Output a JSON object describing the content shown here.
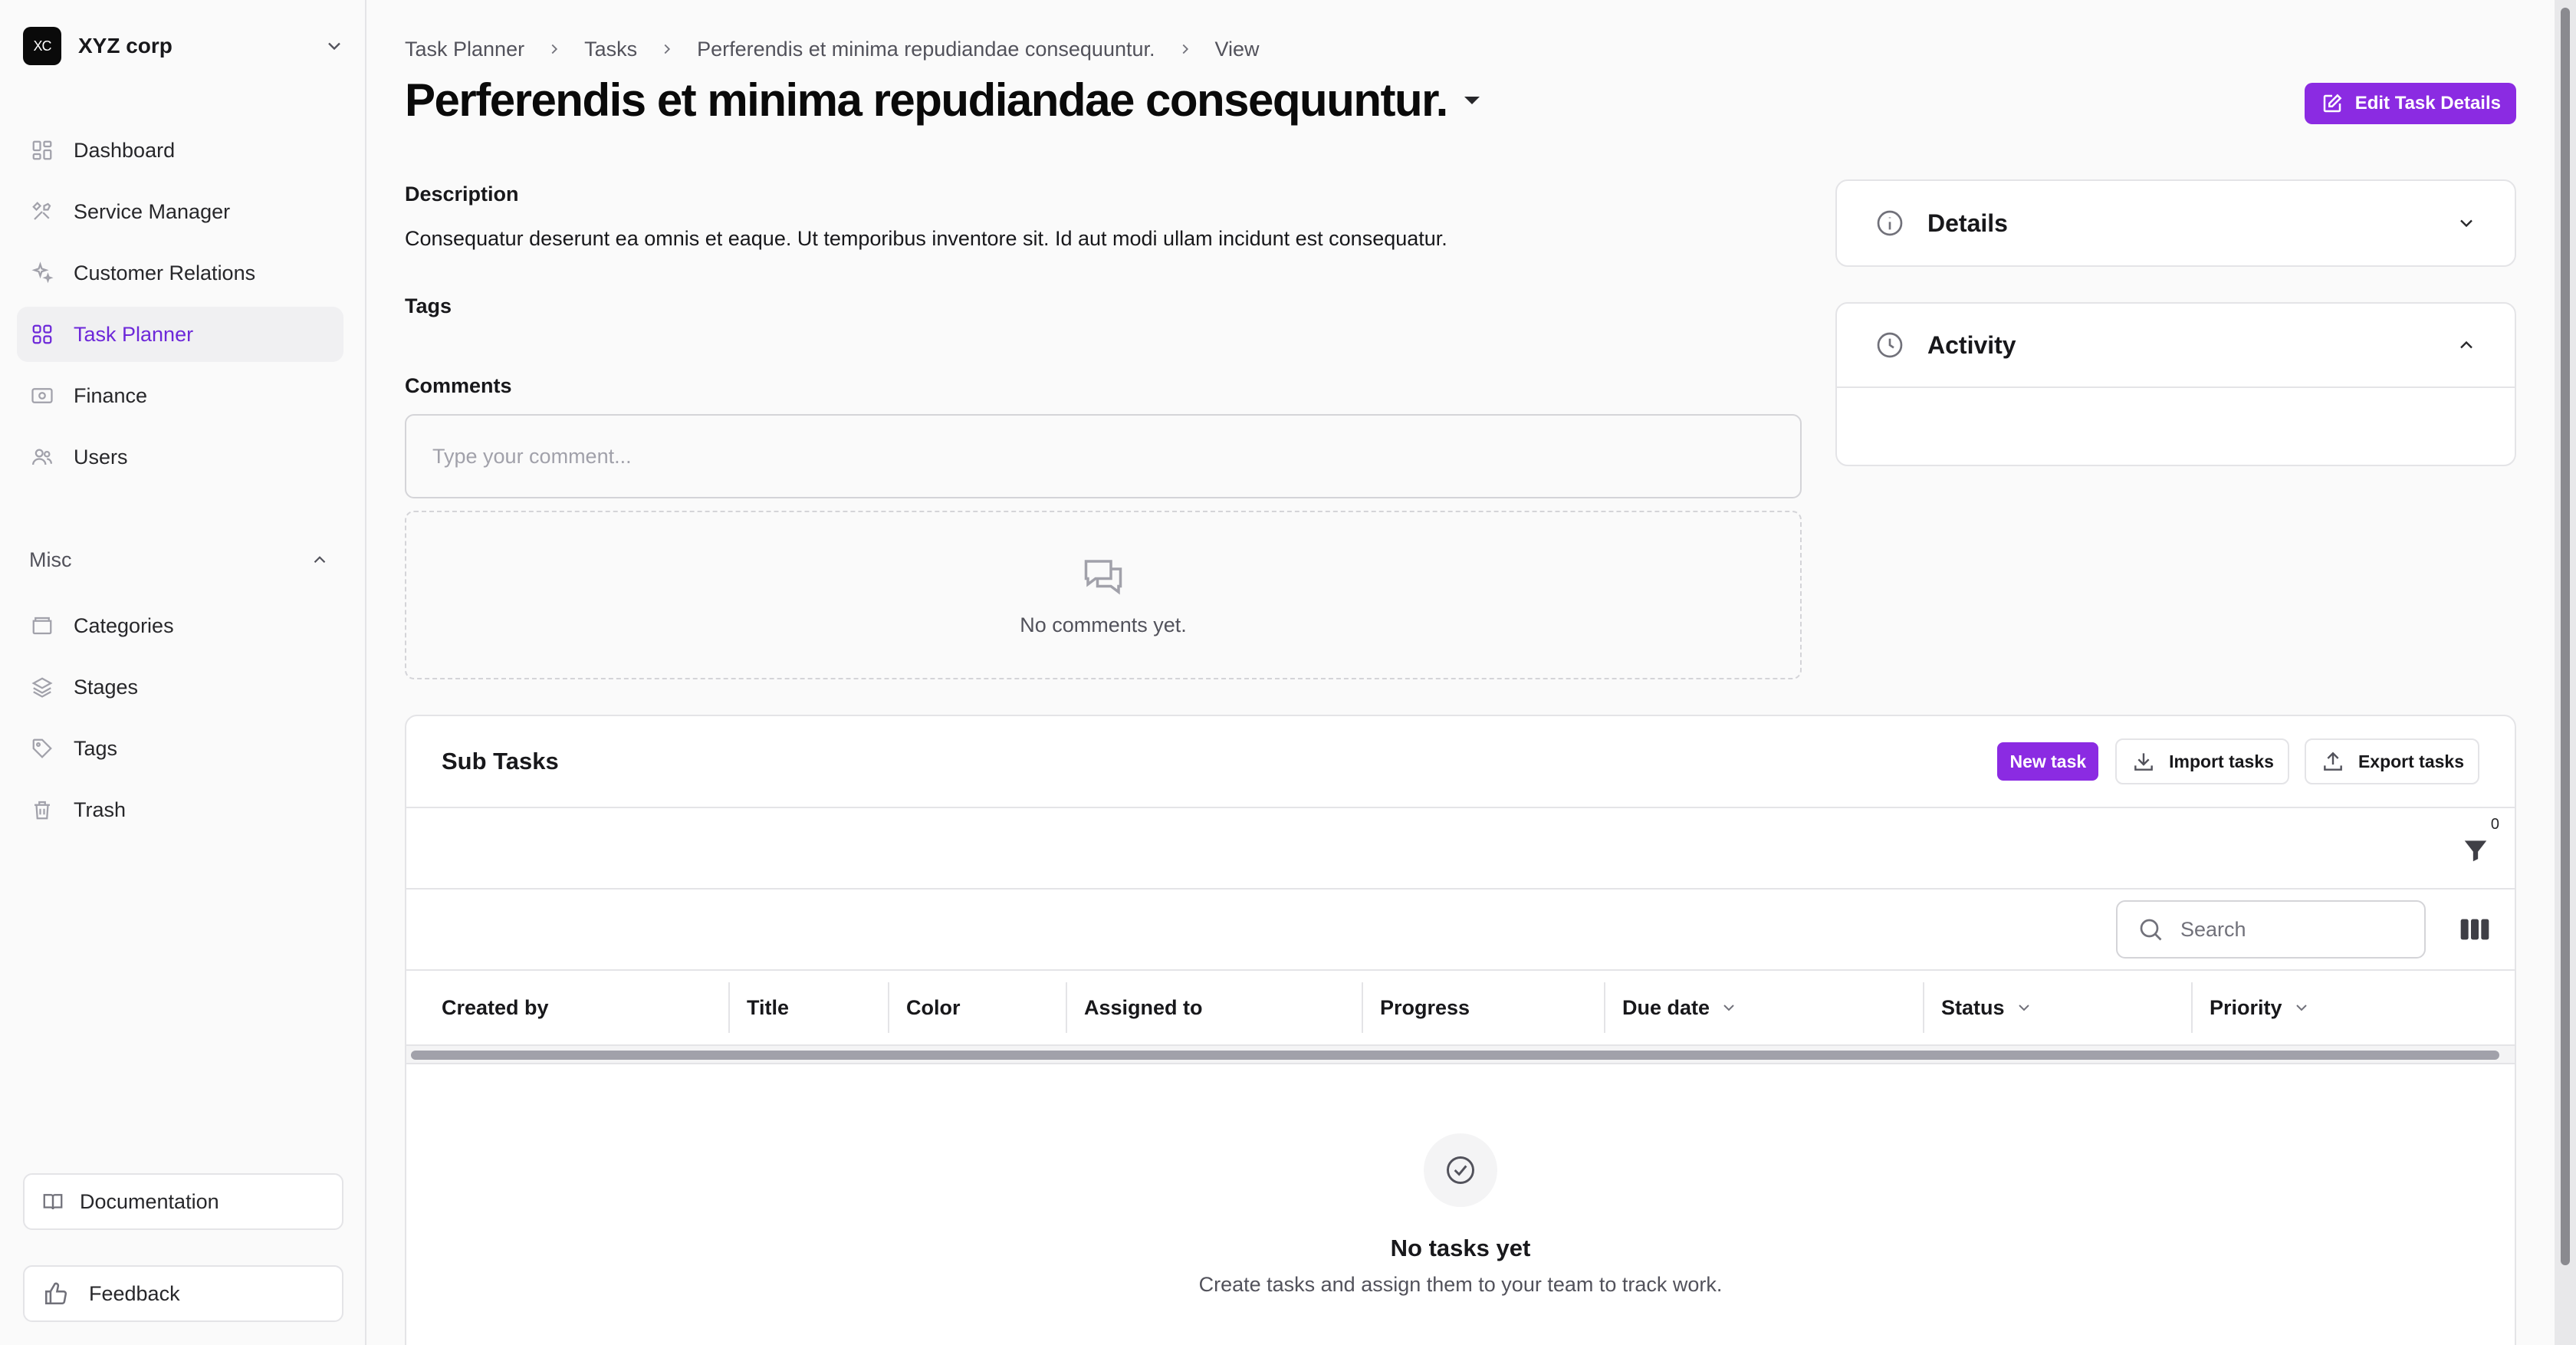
{
  "org": {
    "logo": "XC",
    "name": "XYZ corp"
  },
  "nav": [
    {
      "label": "Dashboard",
      "icon": "dashboard-icon"
    },
    {
      "label": "Service Manager",
      "icon": "tools-icon"
    },
    {
      "label": "Customer Relations",
      "icon": "sparkle-icon"
    },
    {
      "label": "Task Planner",
      "icon": "grid-icon",
      "active": true
    },
    {
      "label": "Finance",
      "icon": "banknote-icon"
    },
    {
      "label": "Users",
      "icon": "users-icon"
    }
  ],
  "misc": {
    "label": "Misc",
    "items": [
      {
        "label": "Categories",
        "icon": "folder-icon"
      },
      {
        "label": "Stages",
        "icon": "layers-icon"
      },
      {
        "label": "Tags",
        "icon": "tag-icon"
      },
      {
        "label": "Trash",
        "icon": "trash-icon"
      }
    ]
  },
  "footer": {
    "documentation": "Documentation",
    "feedback": "Feedback"
  },
  "breadcrumb": [
    "Task Planner",
    "Tasks",
    "Perferendis et minima repudiandae consequuntur.",
    "View"
  ],
  "page": {
    "title": "Perferendis et minima repudiandae consequuntur.",
    "edit_button": "Edit Task Details",
    "description_label": "Description",
    "description": "Consequatur deserunt ea omnis et eaque. Ut temporibus inventore sit. Id aut modi ullam incidunt est consequatur.",
    "tags_label": "Tags",
    "comments_label": "Comments",
    "comment_placeholder": "Type your comment...",
    "no_comments": "No comments yet."
  },
  "panels": {
    "details": "Details",
    "activity": "Activity"
  },
  "subtasks": {
    "title": "Sub Tasks",
    "new_task": "New task",
    "import": "Import tasks",
    "export": "Export tasks",
    "filter_count": "0",
    "search_placeholder": "Search",
    "columns": [
      "Created by",
      "Title",
      "Color",
      "Assigned to",
      "Progress",
      "Due date",
      "Status",
      "Priority"
    ],
    "empty_title": "No tasks yet",
    "empty_sub": "Create tasks and assign them to your team to track work."
  },
  "colors": {
    "accent": "#8b2be2",
    "active_nav": "#6d28d9"
  }
}
